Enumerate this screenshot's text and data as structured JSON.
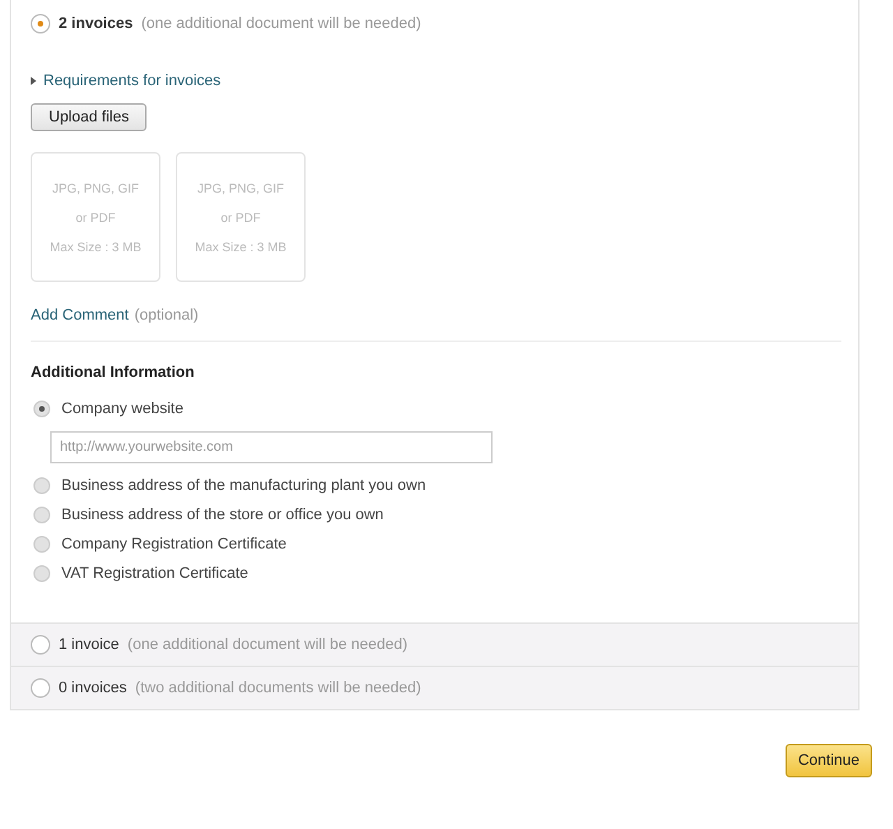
{
  "options": [
    {
      "label": "2 invoices",
      "note": "(one additional document will be needed)",
      "selected": true
    },
    {
      "label": "1 invoice",
      "note": "(one additional document will be needed)",
      "selected": false
    },
    {
      "label": "0 invoices",
      "note": "(two additional documents will be needed)",
      "selected": false
    }
  ],
  "details": {
    "requirements_link": "Requirements for invoices",
    "upload_button": "Upload files",
    "upload_slots": [
      {
        "lines": [
          "JPG, PNG, GIF",
          "or PDF",
          "Max Size : 3 MB"
        ]
      },
      {
        "lines": [
          "JPG, PNG, GIF",
          "or PDF",
          "Max Size : 3 MB"
        ]
      }
    ],
    "comment_link": "Add Comment",
    "comment_note": "(optional)",
    "additional": {
      "heading": "Additional Information",
      "choices": [
        {
          "label": "Company website",
          "selected": true,
          "field": {
            "placeholder": "http://www.yourwebsite.com"
          }
        },
        {
          "label": "Business address of the manufacturing plant you own",
          "selected": false
        },
        {
          "label": "Business address of the store or office you own",
          "selected": false
        },
        {
          "label": "Company Registration Certificate",
          "selected": false
        },
        {
          "label": "VAT Registration Certificate",
          "selected": false
        }
      ]
    }
  },
  "continue_button": "Continue"
}
